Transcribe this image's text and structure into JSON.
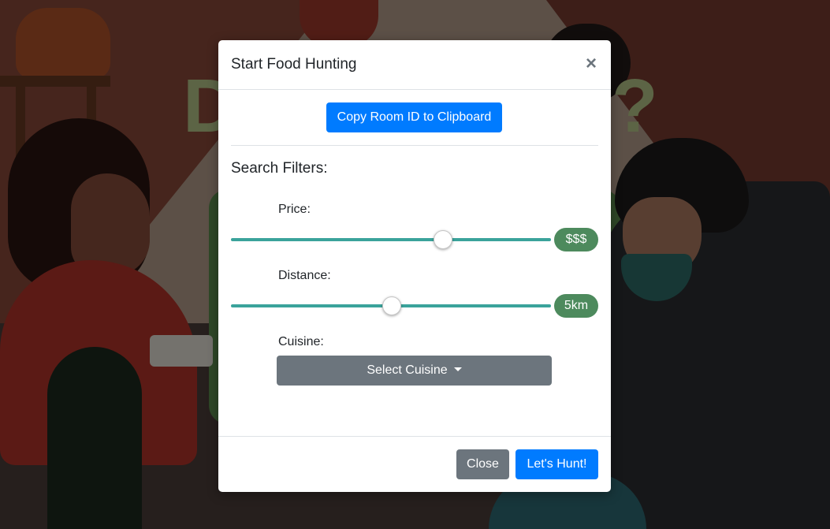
{
  "modal": {
    "title": "Start Food Hunting",
    "close_symbol": "×",
    "copy_button_label": "Copy Room ID to Clipboard",
    "filters_title": "Search Filters:",
    "price": {
      "label": "Price:",
      "value_badge": "$$$",
      "slider_fraction": 0.66
    },
    "distance": {
      "label": "Distance:",
      "value_badge": "5km",
      "slider_fraction": 0.5
    },
    "cuisine": {
      "label": "Cuisine:",
      "button_label": "Select Cuisine"
    },
    "footer": {
      "close_label": "Close",
      "submit_label": "Let's Hunt!"
    }
  },
  "background": {
    "title_left_glyph": "D",
    "title_right_glyph": "?"
  },
  "colors": {
    "primary": "#007bff",
    "secondary": "#6c757d",
    "slider_track": "#3aa39b",
    "badge": "#4d8a5d"
  },
  "icons": {
    "close": "close-icon",
    "dropdown": "chevron-down-icon"
  }
}
